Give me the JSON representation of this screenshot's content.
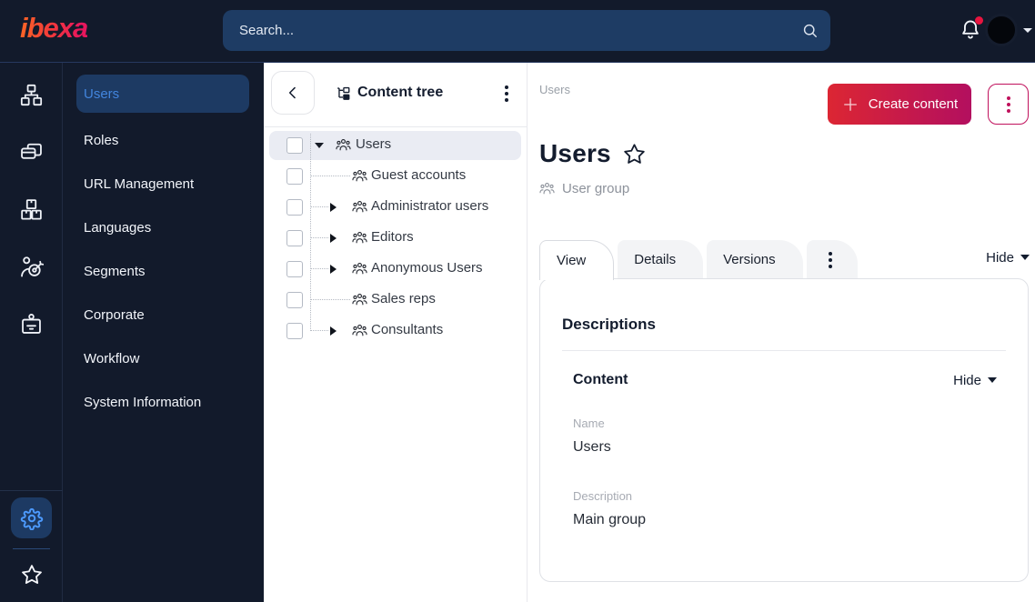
{
  "topbar": {
    "logo_text": "ibexa",
    "search_placeholder": "Search...",
    "notification_badge": true
  },
  "rail": {
    "items": [
      {
        "icon": "sitemap-icon"
      },
      {
        "icon": "pages-icon"
      },
      {
        "icon": "boxes-icon"
      },
      {
        "icon": "person-target-icon"
      },
      {
        "icon": "badge-icon"
      }
    ],
    "bottom_items": [
      {
        "icon": "gear-icon",
        "active": true
      },
      {
        "icon": "star-icon"
      }
    ]
  },
  "sidebar": {
    "items": [
      {
        "label": "Users",
        "active": true
      },
      {
        "label": "Roles"
      },
      {
        "label": "URL Management"
      },
      {
        "label": "Languages"
      },
      {
        "label": "Segments"
      },
      {
        "label": "Corporate"
      },
      {
        "label": "Workflow"
      },
      {
        "label": "System Information"
      }
    ]
  },
  "content_tree": {
    "title": "Content tree",
    "items": [
      {
        "label": "Users",
        "level": 0,
        "expanded": true,
        "selected": true,
        "has_children": true
      },
      {
        "label": "Guest accounts",
        "level": 1,
        "has_children": false
      },
      {
        "label": "Administrator users",
        "level": 1,
        "has_children": true
      },
      {
        "label": "Editors",
        "level": 1,
        "has_children": true
      },
      {
        "label": "Anonymous Users",
        "level": 1,
        "has_children": true
      },
      {
        "label": "Sales reps",
        "level": 1,
        "has_children": false
      },
      {
        "label": "Consultants",
        "level": 1,
        "has_children": true
      }
    ]
  },
  "main": {
    "breadcrumb": "Users",
    "create_button": "Create content",
    "title": "Users",
    "content_type": "User group",
    "tabs": [
      "View",
      "Details",
      "Versions"
    ],
    "hide_toggle": "Hide",
    "card": {
      "heading": "Descriptions",
      "section_title": "Content",
      "section_hide": "Hide",
      "fields": [
        {
          "label": "Name",
          "value": "Users"
        },
        {
          "label": "Description",
          "value": "Main group"
        }
      ]
    }
  },
  "colors": {
    "topbar_bg": "#121a2b",
    "search_bg": "#1e3c64",
    "active_pill_bg": "#1d3a63",
    "active_text_blue": "#4285dd",
    "gear_blue": "#4d9bff",
    "accent_gradient_start": "#dc2633",
    "accent_gradient_end": "#b30f5f",
    "outline_red": "#c0115c",
    "notification_dot": "#e8143f",
    "selected_row_bg": "#eaecf3",
    "dark_text": "#131c2e"
  }
}
